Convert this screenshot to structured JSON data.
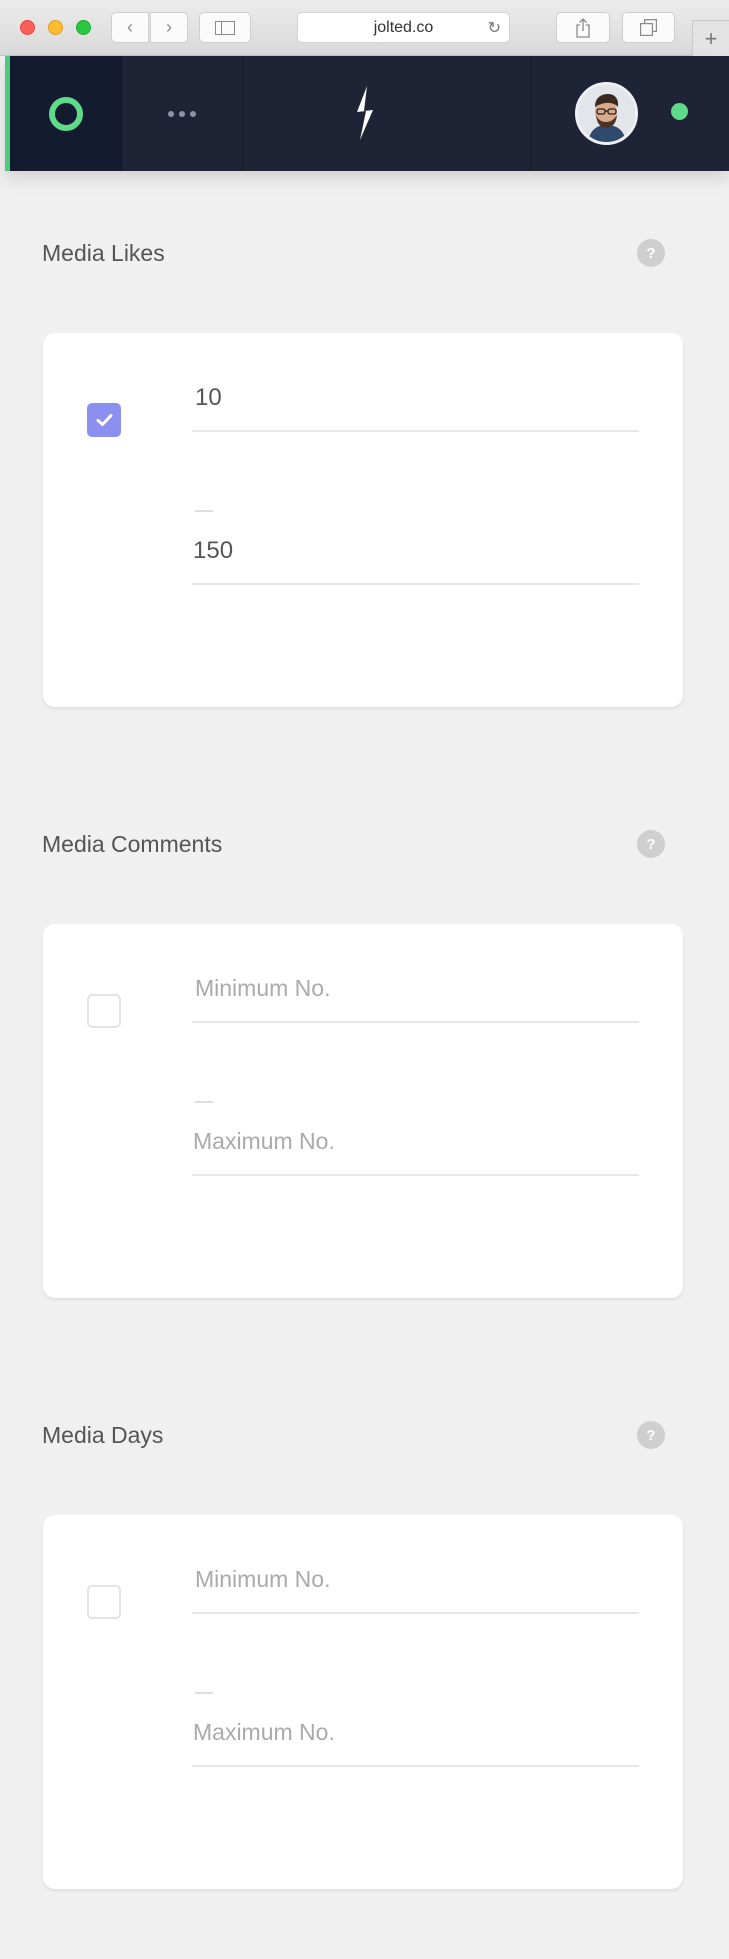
{
  "browser": {
    "url": "jolted.co",
    "back_glyph": "‹",
    "forward_glyph": "›",
    "reload_glyph": "↻",
    "new_tab_glyph": "+"
  },
  "header": {
    "accent_color": "#5fd98a",
    "status_color": "#5fd98a"
  },
  "sections": [
    {
      "title": "Media Likes",
      "help": "?",
      "checked": true,
      "min_value": "10",
      "max_value": "150",
      "min_placeholder": "",
      "max_placeholder": ""
    },
    {
      "title": "Media Comments",
      "help": "?",
      "checked": false,
      "min_value": "",
      "max_value": "",
      "min_placeholder": "Minimum No.",
      "max_placeholder": "Maximum No."
    },
    {
      "title": "Media Days",
      "help": "?",
      "checked": false,
      "min_value": "",
      "max_value": "",
      "min_placeholder": "Minimum No.",
      "max_placeholder": "Maximum No."
    }
  ]
}
